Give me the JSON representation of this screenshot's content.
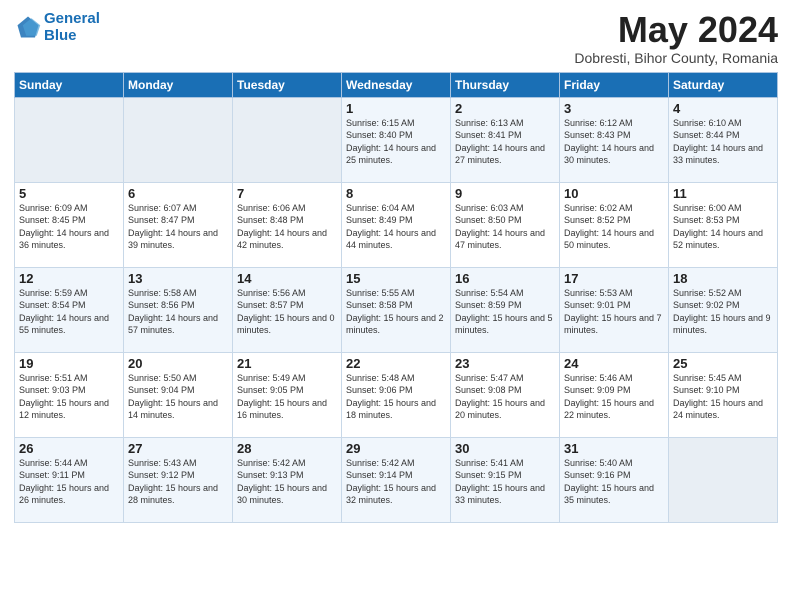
{
  "header": {
    "logo_line1": "General",
    "logo_line2": "Blue",
    "month_title": "May 2024",
    "location": "Dobresti, Bihor County, Romania"
  },
  "weekdays": [
    "Sunday",
    "Monday",
    "Tuesday",
    "Wednesday",
    "Thursday",
    "Friday",
    "Saturday"
  ],
  "weeks": [
    [
      {
        "day": "",
        "sunrise": "",
        "sunset": "",
        "daylight": ""
      },
      {
        "day": "",
        "sunrise": "",
        "sunset": "",
        "daylight": ""
      },
      {
        "day": "",
        "sunrise": "",
        "sunset": "",
        "daylight": ""
      },
      {
        "day": "1",
        "sunrise": "Sunrise: 6:15 AM",
        "sunset": "Sunset: 8:40 PM",
        "daylight": "Daylight: 14 hours and 25 minutes."
      },
      {
        "day": "2",
        "sunrise": "Sunrise: 6:13 AM",
        "sunset": "Sunset: 8:41 PM",
        "daylight": "Daylight: 14 hours and 27 minutes."
      },
      {
        "day": "3",
        "sunrise": "Sunrise: 6:12 AM",
        "sunset": "Sunset: 8:43 PM",
        "daylight": "Daylight: 14 hours and 30 minutes."
      },
      {
        "day": "4",
        "sunrise": "Sunrise: 6:10 AM",
        "sunset": "Sunset: 8:44 PM",
        "daylight": "Daylight: 14 hours and 33 minutes."
      }
    ],
    [
      {
        "day": "5",
        "sunrise": "Sunrise: 6:09 AM",
        "sunset": "Sunset: 8:45 PM",
        "daylight": "Daylight: 14 hours and 36 minutes."
      },
      {
        "day": "6",
        "sunrise": "Sunrise: 6:07 AM",
        "sunset": "Sunset: 8:47 PM",
        "daylight": "Daylight: 14 hours and 39 minutes."
      },
      {
        "day": "7",
        "sunrise": "Sunrise: 6:06 AM",
        "sunset": "Sunset: 8:48 PM",
        "daylight": "Daylight: 14 hours and 42 minutes."
      },
      {
        "day": "8",
        "sunrise": "Sunrise: 6:04 AM",
        "sunset": "Sunset: 8:49 PM",
        "daylight": "Daylight: 14 hours and 44 minutes."
      },
      {
        "day": "9",
        "sunrise": "Sunrise: 6:03 AM",
        "sunset": "Sunset: 8:50 PM",
        "daylight": "Daylight: 14 hours and 47 minutes."
      },
      {
        "day": "10",
        "sunrise": "Sunrise: 6:02 AM",
        "sunset": "Sunset: 8:52 PM",
        "daylight": "Daylight: 14 hours and 50 minutes."
      },
      {
        "day": "11",
        "sunrise": "Sunrise: 6:00 AM",
        "sunset": "Sunset: 8:53 PM",
        "daylight": "Daylight: 14 hours and 52 minutes."
      }
    ],
    [
      {
        "day": "12",
        "sunrise": "Sunrise: 5:59 AM",
        "sunset": "Sunset: 8:54 PM",
        "daylight": "Daylight: 14 hours and 55 minutes."
      },
      {
        "day": "13",
        "sunrise": "Sunrise: 5:58 AM",
        "sunset": "Sunset: 8:56 PM",
        "daylight": "Daylight: 14 hours and 57 minutes."
      },
      {
        "day": "14",
        "sunrise": "Sunrise: 5:56 AM",
        "sunset": "Sunset: 8:57 PM",
        "daylight": "Daylight: 15 hours and 0 minutes."
      },
      {
        "day": "15",
        "sunrise": "Sunrise: 5:55 AM",
        "sunset": "Sunset: 8:58 PM",
        "daylight": "Daylight: 15 hours and 2 minutes."
      },
      {
        "day": "16",
        "sunrise": "Sunrise: 5:54 AM",
        "sunset": "Sunset: 8:59 PM",
        "daylight": "Daylight: 15 hours and 5 minutes."
      },
      {
        "day": "17",
        "sunrise": "Sunrise: 5:53 AM",
        "sunset": "Sunset: 9:01 PM",
        "daylight": "Daylight: 15 hours and 7 minutes."
      },
      {
        "day": "18",
        "sunrise": "Sunrise: 5:52 AM",
        "sunset": "Sunset: 9:02 PM",
        "daylight": "Daylight: 15 hours and 9 minutes."
      }
    ],
    [
      {
        "day": "19",
        "sunrise": "Sunrise: 5:51 AM",
        "sunset": "Sunset: 9:03 PM",
        "daylight": "Daylight: 15 hours and 12 minutes."
      },
      {
        "day": "20",
        "sunrise": "Sunrise: 5:50 AM",
        "sunset": "Sunset: 9:04 PM",
        "daylight": "Daylight: 15 hours and 14 minutes."
      },
      {
        "day": "21",
        "sunrise": "Sunrise: 5:49 AM",
        "sunset": "Sunset: 9:05 PM",
        "daylight": "Daylight: 15 hours and 16 minutes."
      },
      {
        "day": "22",
        "sunrise": "Sunrise: 5:48 AM",
        "sunset": "Sunset: 9:06 PM",
        "daylight": "Daylight: 15 hours and 18 minutes."
      },
      {
        "day": "23",
        "sunrise": "Sunrise: 5:47 AM",
        "sunset": "Sunset: 9:08 PM",
        "daylight": "Daylight: 15 hours and 20 minutes."
      },
      {
        "day": "24",
        "sunrise": "Sunrise: 5:46 AM",
        "sunset": "Sunset: 9:09 PM",
        "daylight": "Daylight: 15 hours and 22 minutes."
      },
      {
        "day": "25",
        "sunrise": "Sunrise: 5:45 AM",
        "sunset": "Sunset: 9:10 PM",
        "daylight": "Daylight: 15 hours and 24 minutes."
      }
    ],
    [
      {
        "day": "26",
        "sunrise": "Sunrise: 5:44 AM",
        "sunset": "Sunset: 9:11 PM",
        "daylight": "Daylight: 15 hours and 26 minutes."
      },
      {
        "day": "27",
        "sunrise": "Sunrise: 5:43 AM",
        "sunset": "Sunset: 9:12 PM",
        "daylight": "Daylight: 15 hours and 28 minutes."
      },
      {
        "day": "28",
        "sunrise": "Sunrise: 5:42 AM",
        "sunset": "Sunset: 9:13 PM",
        "daylight": "Daylight: 15 hours and 30 minutes."
      },
      {
        "day": "29",
        "sunrise": "Sunrise: 5:42 AM",
        "sunset": "Sunset: 9:14 PM",
        "daylight": "Daylight: 15 hours and 32 minutes."
      },
      {
        "day": "30",
        "sunrise": "Sunrise: 5:41 AM",
        "sunset": "Sunset: 9:15 PM",
        "daylight": "Daylight: 15 hours and 33 minutes."
      },
      {
        "day": "31",
        "sunrise": "Sunrise: 5:40 AM",
        "sunset": "Sunset: 9:16 PM",
        "daylight": "Daylight: 15 hours and 35 minutes."
      },
      {
        "day": "",
        "sunrise": "",
        "sunset": "",
        "daylight": ""
      }
    ]
  ]
}
